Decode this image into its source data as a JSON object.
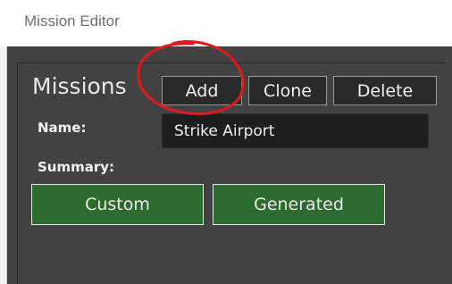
{
  "window": {
    "title": "Mission Editor"
  },
  "missions": {
    "heading": "Missions",
    "add_label": "Add",
    "clone_label": "Clone",
    "delete_label": "Delete"
  },
  "form": {
    "name_label": "Name:",
    "name_value": "Strike Airport",
    "summary_label": "Summary:"
  },
  "summary_tabs": [
    {
      "label": "Custom"
    },
    {
      "label": "Generated"
    }
  ],
  "colors": {
    "panel_bg": "#434343",
    "tab_green": "#2e6b2e",
    "annotation_red": "#e0191c"
  },
  "annotation": {
    "shape": "hand-drawn circle",
    "target": "add-button"
  }
}
